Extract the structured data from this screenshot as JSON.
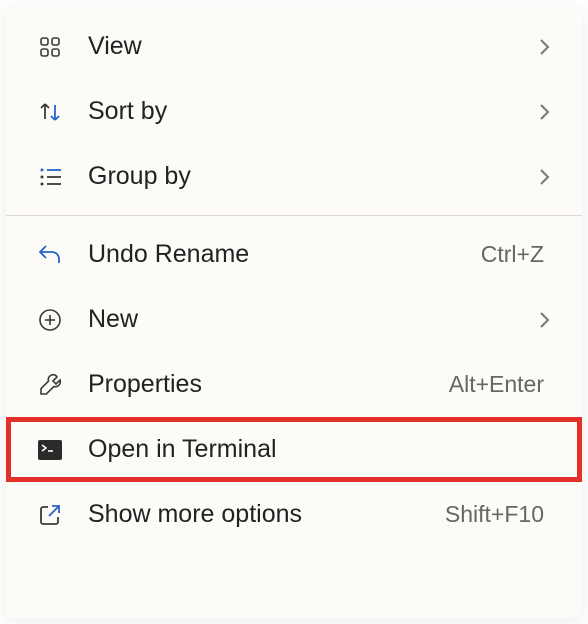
{
  "menu": {
    "items": [
      {
        "label": "View",
        "has_submenu": true
      },
      {
        "label": "Sort by",
        "has_submenu": true
      },
      {
        "label": "Group by",
        "has_submenu": true
      },
      {
        "label": "Undo Rename",
        "shortcut": "Ctrl+Z"
      },
      {
        "label": "New",
        "has_submenu": true
      },
      {
        "label": "Properties",
        "shortcut": "Alt+Enter"
      },
      {
        "label": "Open in Terminal"
      },
      {
        "label": "Show more options",
        "shortcut": "Shift+F10"
      }
    ]
  }
}
